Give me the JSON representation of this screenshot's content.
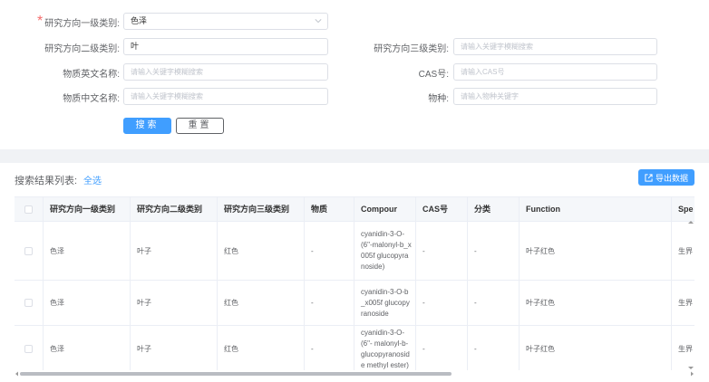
{
  "form": {
    "category1": {
      "label": "研究方向一级类别:",
      "value": "色泽"
    },
    "category2": {
      "label": "研究方向二级类别:",
      "value": "叶"
    },
    "category3": {
      "label": "研究方向三级类别:",
      "placeholder": "请输入关键字模糊搜索"
    },
    "name_en": {
      "label": "物质英文名称:",
      "placeholder": "请输入关键字模糊搜索"
    },
    "cas": {
      "label": "CAS号:",
      "placeholder": "请输入CAS号"
    },
    "name_cn": {
      "label": "物质中文名称:",
      "placeholder": "请输入关键字模糊搜索"
    },
    "species": {
      "label": "物种:",
      "placeholder": "请输入物种关键字"
    },
    "search_label": "搜索",
    "reset_label": "重置"
  },
  "results": {
    "title": "搜索结果列表:",
    "select_all": "全选",
    "export_label": "导出数据",
    "columns": [
      "研究方向一级类别",
      "研究方向二级类别",
      "研究方向三级类别",
      "物质",
      "Compour",
      "CAS号",
      "分类",
      "Function",
      "Spe"
    ],
    "rows": [
      {
        "c1": "色泽",
        "c2": "叶子",
        "c3": "红色",
        "substance": "-",
        "compound": "cyanidin-3-O-(6\"-malonyl-b_x005f glucopyranoside)",
        "cas": "-",
        "cls": "-",
        "function": "叶子红色",
        "species": "生界"
      },
      {
        "c1": "色泽",
        "c2": "叶子",
        "c3": "红色",
        "substance": "-",
        "compound": "cyanidin-3-O-b_x005f glucopyranoside",
        "cas": "-",
        "cls": "-",
        "function": "叶子红色",
        "species": "生界"
      },
      {
        "c1": "色泽",
        "c2": "叶子",
        "c3": "红色",
        "substance": "-",
        "compound": "cyanidin-3-O-(6\"- malonyl-b-glucopyranoside methyl ester)",
        "cas": "-",
        "cls": "-",
        "function": "叶子红色",
        "species": "生界"
      }
    ]
  },
  "colors": {
    "primary": "#409eff",
    "required": "#f56c6c",
    "border": "#dcdfe6",
    "header_bg": "#f5f7fa",
    "page_bg": "#f0f2f5"
  },
  "icons": {
    "select_arrow": "chevron-down-icon",
    "export": "export-icon"
  }
}
